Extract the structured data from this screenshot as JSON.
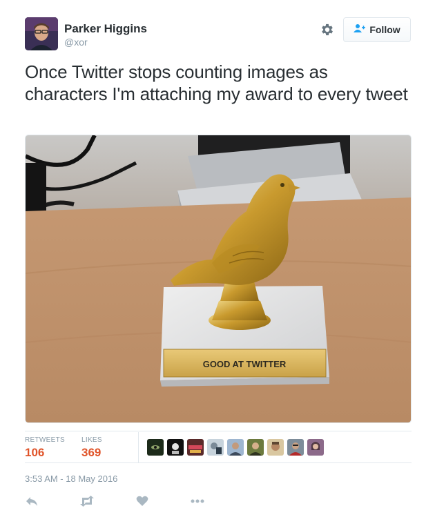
{
  "user": {
    "name": "Parker Higgins",
    "handle": "@xor",
    "avatar_icon": "profile-avatar"
  },
  "header": {
    "settings_icon": "gear-icon",
    "follow_label": "Follow",
    "follow_icon": "add-user-icon"
  },
  "tweet": {
    "text": "Once Twitter stops counting images as characters I'm attaching my award to every tweet",
    "image": {
      "subject": "golden pigeon trophy on marble base",
      "plaque_text": "GOOD AT TWITTER"
    }
  },
  "stats": {
    "retweets_label": "RETWEETS",
    "retweets_value": "106",
    "likes_label": "LIKES",
    "likes_value": "369",
    "liker_avatar_count": 9
  },
  "timestamp": "3:53 AM - 18 May 2016",
  "actions": [
    {
      "name": "reply",
      "icon": "reply-icon"
    },
    {
      "name": "retweet",
      "icon": "retweet-icon"
    },
    {
      "name": "like",
      "icon": "heart-icon"
    },
    {
      "name": "more",
      "icon": "more-dots-icon"
    }
  ],
  "colors": {
    "text": "#292f33",
    "muted": "#8899a6",
    "stat_value": "#e0542a",
    "action_icon": "#aab8c2",
    "follow_icon": "#1da1f2"
  }
}
